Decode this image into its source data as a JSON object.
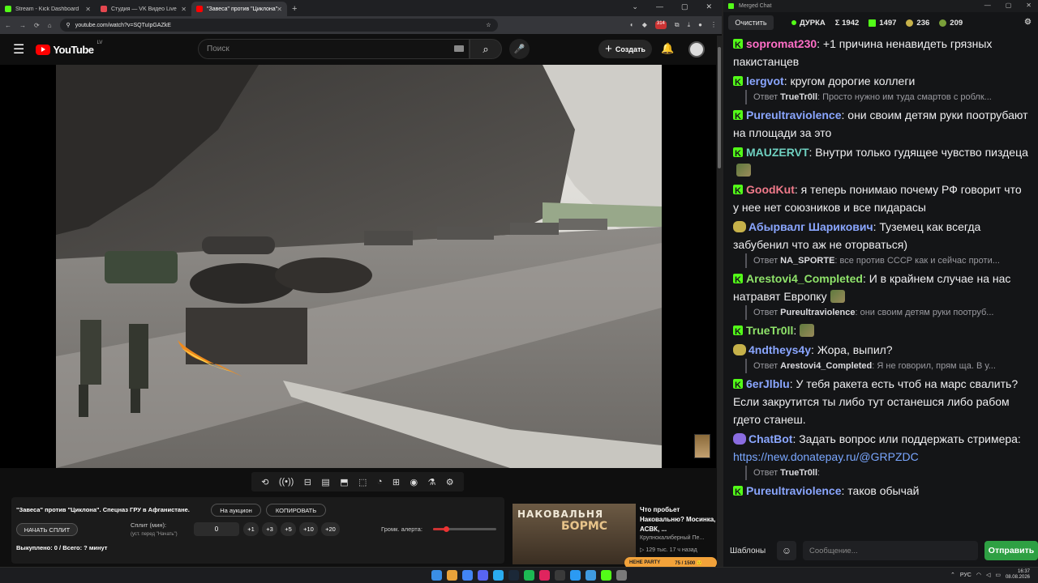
{
  "browser": {
    "tabs": [
      {
        "title": "Stream - Kick Dashboard",
        "color": "#53fc18"
      },
      {
        "title": "Студия — VK Видео Live",
        "color": "#e5474f"
      },
      {
        "title": "\"Завеса\" против \"Циклона\"",
        "color": "#ff0000"
      }
    ],
    "new_tab": "+",
    "window_controls": [
      "⌄",
      "—",
      "▢",
      "✕"
    ],
    "url": "youtube.com/watch?v=SQTuIpGAZkE",
    "nav_icons": [
      "←",
      "→",
      "⟳",
      "⌂"
    ],
    "ext_badge": "314"
  },
  "youtube": {
    "logo": "YouTube",
    "region": "LV",
    "search_placeholder": "Поиск",
    "create_label": "Создать",
    "create_plus": "+",
    "menu_icon": "☰",
    "bell_icon": "🔔",
    "search_icon": "⌕",
    "mic_icon": "🎤"
  },
  "player_controls": [
    "⟲",
    "((•))",
    "⊟",
    "▤",
    "⬒",
    "⬚",
    "◔",
    "⊞",
    "◉",
    "⚗",
    "⚙"
  ],
  "panel": {
    "video_title": "\"Завеса\" против \"Циклона\". Спецназ ГРУ в Афганистане.",
    "auction_label": "На аукцион",
    "copy_label": "КОПИРОВАТЬ",
    "split_button": "НАЧАТЬ СПЛИТ",
    "split_label": "Сплит (мин):",
    "split_hint": "(уст. перед \"Начать\")",
    "split_value": "0",
    "increments": [
      "+1",
      "+3",
      "+5",
      "+10",
      "+20"
    ],
    "bought": "Выкуплено: 0 / Всего: ? минут",
    "alert_volume_label": "Громк. алерта:",
    "alert_volume": 0.2
  },
  "recommendation": {
    "thumb_line1": "НАКОВАЛЬНЯ",
    "thumb_line2": "БОРМС",
    "title": "Что пробьет Наковальню? Мосинка, АСВК, ...",
    "channel": "Крупнокалиберный Пе...",
    "meta": "▷ 129 тыс.   17 ч назад"
  },
  "hehe_bar": {
    "label": "HEHE PARTY",
    "count": "75 / 1500 🙂"
  },
  "chat": {
    "window_title": "Merged Chat",
    "window_controls": [
      "—",
      "▢",
      "✕"
    ],
    "clear_label": "Очистить",
    "stats": {
      "title": "ДУРКА",
      "sigma": "Σ 1942",
      "kick": "1497",
      "vk": "236",
      "yt": "209"
    },
    "settings_icon": "⚙",
    "messages": [
      {
        "platform": "kick",
        "user": "sopromat230",
        "color": "#ff6ec7",
        "text": ": +1 причина ненавидеть грязных пакистанцев"
      },
      {
        "platform": "kick",
        "user": "lergvot",
        "color": "#8aa6ff",
        "text": ": кругом дорогие коллеги",
        "reply": {
          "prefix": "Ответ",
          "user": "TrueTr0ll",
          "text": ": Просто нужно им туда смартов с роблк..."
        }
      },
      {
        "platform": "kick",
        "user": "Pureultraviolence",
        "color": "#8aa6ff",
        "text": ": они своим детям руки поотрубают на площади за это"
      },
      {
        "platform": "kick",
        "user": "MAUZERVT",
        "color": "#6fd0c0",
        "text": ": Внутри только гудящее чувство пиздеца",
        "pic": true
      },
      {
        "platform": "kick",
        "user": "GoodKut",
        "color": "#f07a8a",
        "text": ": я теперь понимаю почему РФ говорит что у нее нет союзников и все пидарасы"
      },
      {
        "platform": "vk",
        "user": "Абырвалг Шарикович",
        "color": "#8aa6ff",
        "text": ": Туземец как всегда забубенил что аж не оторваться)",
        "reply": {
          "prefix": "Ответ",
          "user": "NA_SPORTE",
          "text": ": все против СССР как и сейчас проти..."
        }
      },
      {
        "platform": "kick",
        "user": "Arestovi4_Completed",
        "color": "#8fe36a",
        "text": ": И в крайнем случае на нас натравят Европку",
        "pic": true,
        "reply": {
          "prefix": "Ответ",
          "user": "Pureultraviolence",
          "text": ": они своим детям руки поотруб..."
        }
      },
      {
        "platform": "kick",
        "user": "TrueTr0ll",
        "color": "#8fe36a",
        "text": ":",
        "pic": true
      },
      {
        "platform": "vk",
        "user": "4ndtheys4y",
        "color": "#8aa6ff",
        "text": ": Жора, выпил?",
        "reply": {
          "prefix": "Ответ",
          "user": "Arestovi4_Completed",
          "text": ": Я не говорил, прям ща. В у..."
        }
      },
      {
        "platform": "kick",
        "user": "6erJlblu",
        "color": "#8aa6ff",
        "text": ": У тебя ракета есть чтоб на марс свалить? Если закрутится ты либо тут останешся либо рабом гдето станеш."
      },
      {
        "platform": "bot",
        "user": "ChatBot",
        "color": "#8aa6ff",
        "text": ": Задать вопрос или поддержать стримера: ",
        "link": "https://new.donatepay.ru/@GRPZDC",
        "reply": {
          "prefix": "Ответ",
          "user": "TrueTr0ll",
          "text": ":",
          "pic": true
        }
      },
      {
        "platform": "kick",
        "user": "Pureultraviolence",
        "color": "#8aa6ff",
        "text": ": таков обычай"
      }
    ],
    "templates_label": "Шаблоны",
    "emoji_icon": "☺",
    "input_placeholder": "Сообщение...",
    "send_label": "Отправить"
  },
  "taskbar": {
    "icons": [
      "#3a8ee6",
      "#e8a23a",
      "#4285f4",
      "#5865f2",
      "#2aabee",
      "#1b2838",
      "#1db954",
      "#e0245e",
      "#3a3a3a",
      "#2b9af3",
      "#3f9ae0",
      "#53fc18",
      "#7a7a7a"
    ],
    "lang": "РУС",
    "time": "16:37",
    "date": "08.08.2026"
  }
}
